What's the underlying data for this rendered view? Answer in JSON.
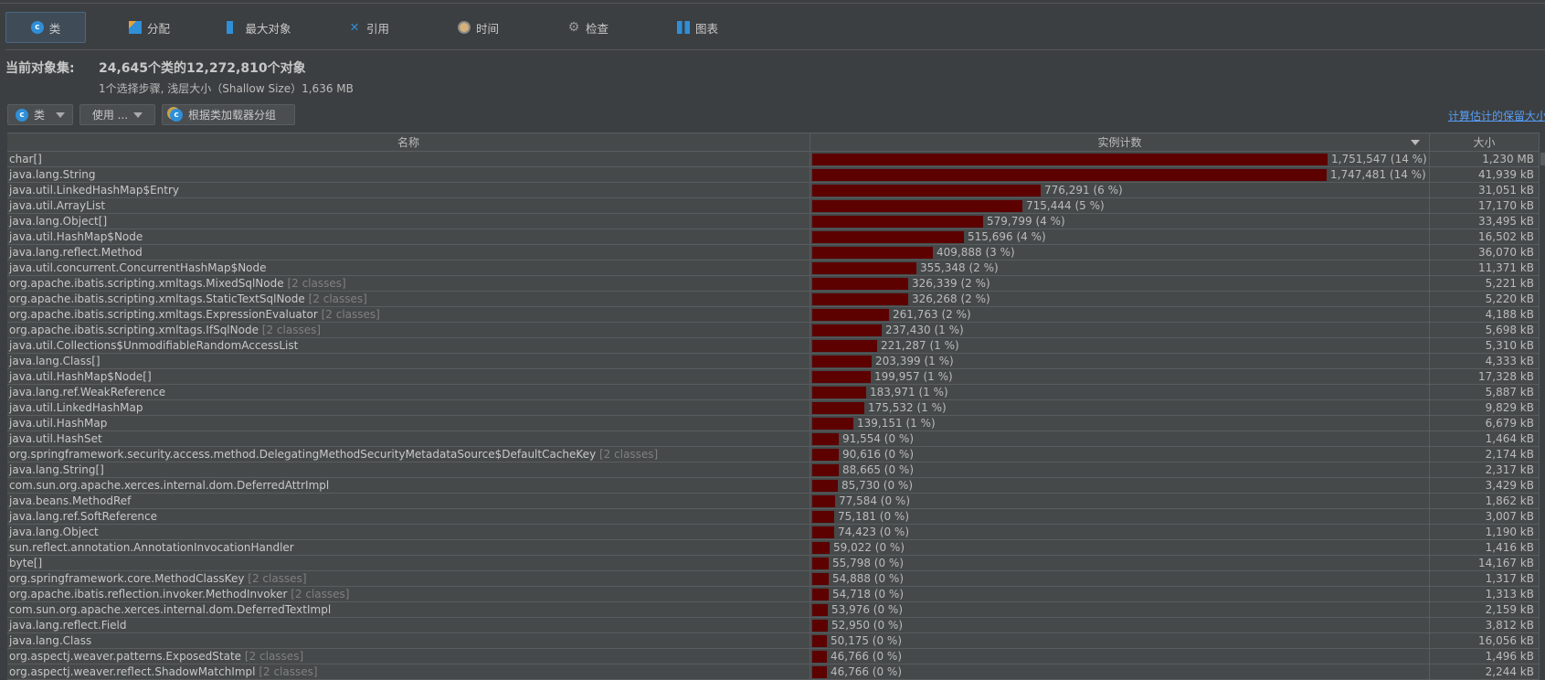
{
  "tabs": [
    {
      "label": "类",
      "icon": "class-icon"
    },
    {
      "label": "分配",
      "icon": "allocation-icon"
    },
    {
      "label": "最大对象",
      "icon": "biggest-objects-icon"
    },
    {
      "label": "引用",
      "icon": "references-icon"
    },
    {
      "label": "时间",
      "icon": "clock-icon"
    },
    {
      "label": "检查",
      "icon": "gear-icon"
    },
    {
      "label": "图表",
      "icon": "graph-icon"
    }
  ],
  "header": {
    "label": "当前对象集:",
    "value": "24,645个类的12,272,810个对象",
    "sub": "1个选择步骤, 浅层大小（Shallow Size）1,636 MB"
  },
  "toolbar": {
    "view_label": "类",
    "use_label": "使用 ...",
    "group_label": "根据类加载器分组",
    "retained_link": "计算估计的保留大小"
  },
  "columns": {
    "name": "名称",
    "count": "实例计数",
    "size": "大小"
  },
  "max_count": 1751547,
  "rows": [
    {
      "name": "char[]",
      "extra": "",
      "count": 1751547,
      "count_text": "1,751,547 (14 %)",
      "size": "1,230 MB"
    },
    {
      "name": "java.lang.String",
      "extra": "",
      "count": 1747481,
      "count_text": "1,747,481 (14 %)",
      "size": "41,939 kB"
    },
    {
      "name": "java.util.LinkedHashMap$Entry",
      "extra": "",
      "count": 776291,
      "count_text": "776,291 (6 %)",
      "size": "31,051 kB"
    },
    {
      "name": "java.util.ArrayList",
      "extra": "",
      "count": 715444,
      "count_text": "715,444 (5 %)",
      "size": "17,170 kB"
    },
    {
      "name": "java.lang.Object[]",
      "extra": "",
      "count": 579799,
      "count_text": "579,799 (4 %)",
      "size": "33,495 kB"
    },
    {
      "name": "java.util.HashMap$Node",
      "extra": "",
      "count": 515696,
      "count_text": "515,696 (4 %)",
      "size": "16,502 kB"
    },
    {
      "name": "java.lang.reflect.Method",
      "extra": "",
      "count": 409888,
      "count_text": "409,888 (3 %)",
      "size": "36,070 kB"
    },
    {
      "name": "java.util.concurrent.ConcurrentHashMap$Node",
      "extra": "",
      "count": 355348,
      "count_text": "355,348 (2 %)",
      "size": "11,371 kB"
    },
    {
      "name": "org.apache.ibatis.scripting.xmltags.MixedSqlNode",
      "extra": "[2 classes]",
      "count": 326339,
      "count_text": "326,339 (2 %)",
      "size": "5,221 kB"
    },
    {
      "name": "org.apache.ibatis.scripting.xmltags.StaticTextSqlNode",
      "extra": "[2 classes]",
      "count": 326268,
      "count_text": "326,268 (2 %)",
      "size": "5,220 kB"
    },
    {
      "name": "org.apache.ibatis.scripting.xmltags.ExpressionEvaluator",
      "extra": "[2 classes]",
      "count": 261763,
      "count_text": "261,763 (2 %)",
      "size": "4,188 kB"
    },
    {
      "name": "org.apache.ibatis.scripting.xmltags.IfSqlNode",
      "extra": "[2 classes]",
      "count": 237430,
      "count_text": "237,430 (1 %)",
      "size": "5,698 kB"
    },
    {
      "name": "java.util.Collections$UnmodifiableRandomAccessList",
      "extra": "",
      "count": 221287,
      "count_text": "221,287 (1 %)",
      "size": "5,310 kB"
    },
    {
      "name": "java.lang.Class[]",
      "extra": "",
      "count": 203399,
      "count_text": "203,399 (1 %)",
      "size": "4,333 kB"
    },
    {
      "name": "java.util.HashMap$Node[]",
      "extra": "",
      "count": 199957,
      "count_text": "199,957 (1 %)",
      "size": "17,328 kB"
    },
    {
      "name": "java.lang.ref.WeakReference",
      "extra": "",
      "count": 183971,
      "count_text": "183,971 (1 %)",
      "size": "5,887 kB"
    },
    {
      "name": "java.util.LinkedHashMap",
      "extra": "",
      "count": 175532,
      "count_text": "175,532 (1 %)",
      "size": "9,829 kB"
    },
    {
      "name": "java.util.HashMap",
      "extra": "",
      "count": 139151,
      "count_text": "139,151 (1 %)",
      "size": "6,679 kB"
    },
    {
      "name": "java.util.HashSet",
      "extra": "",
      "count": 91554,
      "count_text": "91,554 (0 %)",
      "size": "1,464 kB"
    },
    {
      "name": "org.springframework.security.access.method.DelegatingMethodSecurityMetadataSource$DefaultCacheKey",
      "extra": "[2 classes]",
      "count": 90616,
      "count_text": "90,616 (0 %)",
      "size": "2,174 kB"
    },
    {
      "name": "java.lang.String[]",
      "extra": "",
      "count": 88665,
      "count_text": "88,665 (0 %)",
      "size": "2,317 kB"
    },
    {
      "name": "com.sun.org.apache.xerces.internal.dom.DeferredAttrImpl",
      "extra": "",
      "count": 85730,
      "count_text": "85,730 (0 %)",
      "size": "3,429 kB"
    },
    {
      "name": "java.beans.MethodRef",
      "extra": "",
      "count": 77584,
      "count_text": "77,584 (0 %)",
      "size": "1,862 kB"
    },
    {
      "name": "java.lang.ref.SoftReference",
      "extra": "",
      "count": 75181,
      "count_text": "75,181 (0 %)",
      "size": "3,007 kB"
    },
    {
      "name": "java.lang.Object",
      "extra": "",
      "count": 74423,
      "count_text": "74,423 (0 %)",
      "size": "1,190 kB"
    },
    {
      "name": "sun.reflect.annotation.AnnotationInvocationHandler",
      "extra": "",
      "count": 59022,
      "count_text": "59,022 (0 %)",
      "size": "1,416 kB"
    },
    {
      "name": "byte[]",
      "extra": "",
      "count": 55798,
      "count_text": "55,798 (0 %)",
      "size": "14,167 kB"
    },
    {
      "name": "org.springframework.core.MethodClassKey",
      "extra": "[2 classes]",
      "count": 54888,
      "count_text": "54,888 (0 %)",
      "size": "1,317 kB"
    },
    {
      "name": "org.apache.ibatis.reflection.invoker.MethodInvoker",
      "extra": "[2 classes]",
      "count": 54718,
      "count_text": "54,718 (0 %)",
      "size": "1,313 kB"
    },
    {
      "name": "com.sun.org.apache.xerces.internal.dom.DeferredTextImpl",
      "extra": "",
      "count": 53976,
      "count_text": "53,976 (0 %)",
      "size": "2,159 kB"
    },
    {
      "name": "java.lang.reflect.Field",
      "extra": "",
      "count": 52950,
      "count_text": "52,950 (0 %)",
      "size": "3,812 kB"
    },
    {
      "name": "java.lang.Class",
      "extra": "",
      "count": 50175,
      "count_text": "50,175 (0 %)",
      "size": "16,056 kB"
    },
    {
      "name": "org.aspectj.weaver.patterns.ExposedState",
      "extra": "[2 classes]",
      "count": 46766,
      "count_text": "46,766 (0 %)",
      "size": "1,496 kB"
    },
    {
      "name": "org.aspectj.weaver.reflect.ShadowMatchImpl",
      "extra": "[2 classes]",
      "count": 46766,
      "count_text": "46,766 (0 %)",
      "size": "2,244 kB"
    }
  ]
}
